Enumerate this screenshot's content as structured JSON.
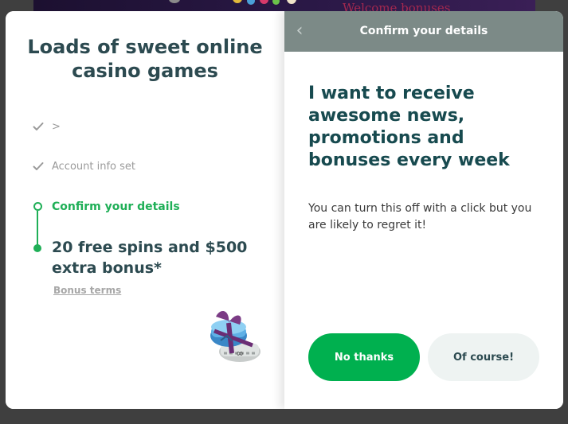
{
  "background": {
    "banner_text": "Welcome bonuses"
  },
  "left_panel": {
    "title": "Loads of sweet online casino games",
    "steps": [
      {
        "label": ">",
        "state": "done",
        "icon": "check-icon"
      },
      {
        "label": "Account info set",
        "state": "done",
        "icon": "check-icon"
      },
      {
        "label": "Confirm your details",
        "state": "active",
        "icon": "progress-dot-icon"
      }
    ],
    "reward_text": "20 free spins and $500 extra bonus*",
    "bonus_terms_link": "Bonus terms",
    "illustration": "gift-box-icon"
  },
  "right_panel": {
    "header": {
      "title": "Confirm your details",
      "back_icon": "chevron-left-icon"
    },
    "headline": "I want to receive awesome news, promotions and bonuses every week",
    "subtext": "You can turn this off with a click but you are likely to regret it!",
    "buttons": {
      "decline_label": "No thanks",
      "accept_label": "Of course!"
    }
  },
  "colors": {
    "accent_green": "#00b04f",
    "step_active": "#1faf57",
    "header_bg": "#7c8a87",
    "heading_text": "#174a4f",
    "page_bg": "#3f3f3f"
  }
}
